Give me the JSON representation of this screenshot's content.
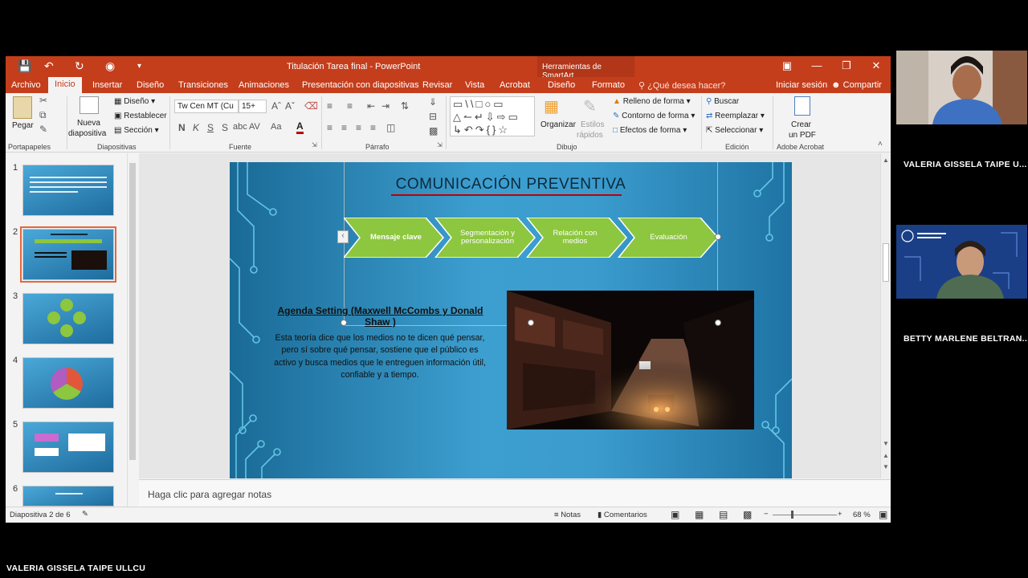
{
  "window": {
    "title": "Titulación Tarea final - PowerPoint",
    "context_tab": "Herramientas de SmartArt",
    "buttons": [
      "restore-ribbon",
      "minimize",
      "maximize",
      "close"
    ]
  },
  "tabs": {
    "archivo": "Archivo",
    "inicio": "Inicio",
    "insertar": "Insertar",
    "diseno": "Diseño",
    "transiciones": "Transiciones",
    "animaciones": "Animaciones",
    "presentacion": "Presentación con diapositivas",
    "revisar": "Revisar",
    "vista": "Vista",
    "acrobat": "Acrobat",
    "diseno2": "Diseño",
    "formato": "Formato",
    "tell_me": "¿Qué desea hacer?",
    "signin": "Iniciar sesión",
    "share": "Compartir"
  },
  "ribbon": {
    "paste": "Pegar",
    "clipboard": "Portapapeles",
    "new_slide_1": "Nueva",
    "new_slide_2": "diapositiva",
    "layout": "Diseño",
    "reset": "Restablecer",
    "section": "Sección",
    "slides": "Diapositivas",
    "font_name": "Tw Cen MT (Cu",
    "font_size": "15+",
    "font": "Fuente",
    "paragraph": "Párrafo",
    "arrange": "Organizar",
    "styles_1": "Estilos",
    "styles_2": "rápidos",
    "shape_fill": "Relleno de forma",
    "shape_outline": "Contorno de forma",
    "shape_effects": "Efectos de forma",
    "drawing": "Dibujo",
    "find": "Buscar",
    "replace": "Reemplazar",
    "select": "Seleccionar",
    "editing": "Edición",
    "pdf_1": "Crear",
    "pdf_2": "un PDF",
    "acrobat": "Adobe Acrobat"
  },
  "thumbnails": [
    {
      "num": "1"
    },
    {
      "num": "2"
    },
    {
      "num": "3"
    },
    {
      "num": "4"
    },
    {
      "num": "5"
    },
    {
      "num": "6"
    }
  ],
  "slide": {
    "title": "COMUNICACIÓN PREVENTIVA",
    "steps": [
      "Mensaje clave",
      "Segmentación y personalización",
      "Relación con medios",
      "Evaluación"
    ],
    "heading": "Agenda Setting (Maxwell McCombs y Donald Shaw )",
    "body": "Esta teoría dice que los medios no te dicen qué pensar, pero sí sobre qué pensar, sostiene que el público es activo y busca medios que le entreguen información útil, confiable y a tiempo."
  },
  "notes_placeholder": "Haga clic para agregar notas",
  "status": {
    "slide_of": "Diapositiva 2 de 6",
    "notes": "Notas",
    "comments": "Comentarios",
    "zoom": "68 %"
  },
  "participants": {
    "p1": "VALERIA GISSELA TAIPE U...",
    "p2": "BETTY MARLENE BELTRAN...",
    "active": "VALERIA GISSELA TAIPE ULLCU"
  },
  "colors": {
    "accent": "#c43e1c",
    "chevron": "#8dc63f",
    "slide_bg": "#3b9bcd"
  }
}
